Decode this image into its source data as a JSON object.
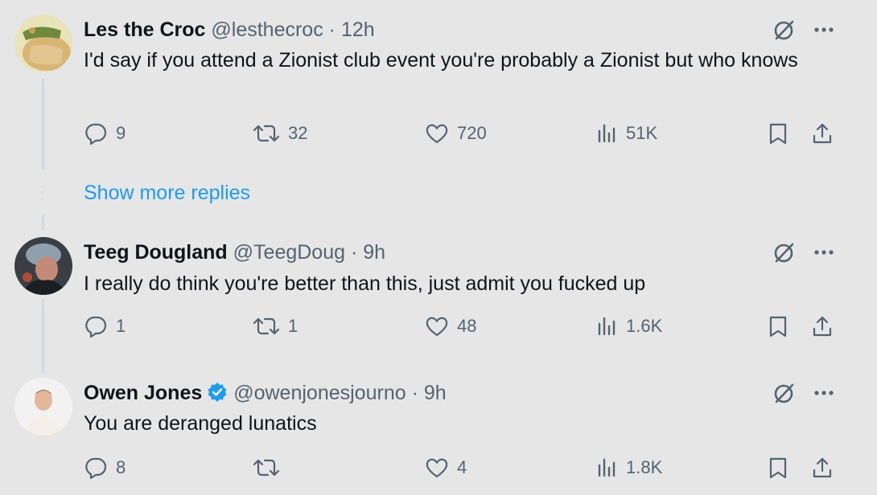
{
  "replies": [
    {
      "name": "Les the Croc",
      "handle": "@lesthecroc",
      "sep": "·",
      "time": "12h",
      "verified": false,
      "text": "I'd say if you attend a Zionist club event you're probably a Zionist but who knows",
      "stats": {
        "replies": "9",
        "reposts": "32",
        "likes": "720",
        "views": "51K"
      }
    },
    {
      "name": "Teeg Dougland",
      "handle": "@TeegDoug",
      "sep": "·",
      "time": "9h",
      "verified": false,
      "text": "I really do think you're better than this, just admit you fucked up",
      "stats": {
        "replies": "1",
        "reposts": "1",
        "likes": "48",
        "views": "1.6K"
      }
    },
    {
      "name": "Owen Jones",
      "handle": "@owenjonesjourno",
      "sep": "·",
      "time": "9h",
      "verified": true,
      "text": "You are deranged lunatics",
      "stats": {
        "replies": "8",
        "reposts": "",
        "likes": "4",
        "views": "1.8K"
      }
    }
  ],
  "show_more_label": "Show more replies",
  "colors": {
    "background": "#e6e6e6",
    "link": "#1d9bf0",
    "muted": "#536471",
    "verified": "#1d9bf0"
  },
  "icons": [
    "grok-icon",
    "more-icon",
    "reply-icon",
    "repost-icon",
    "like-icon",
    "views-icon",
    "bookmark-icon",
    "share-icon",
    "verified-badge-icon"
  ]
}
